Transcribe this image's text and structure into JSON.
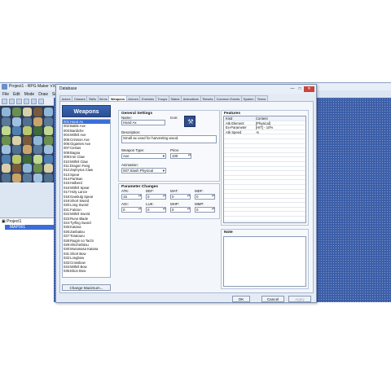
{
  "main_window": {
    "title": "Project1 - RPG Maker VX Ace",
    "menu": [
      "File",
      "Edit",
      "Mode",
      "Draw",
      "Scale"
    ]
  },
  "project_tree": {
    "root": "Project1",
    "selected_map": "MAP001"
  },
  "dialog": {
    "title": "Database",
    "close_label": "✕",
    "min_label": "—",
    "max_label": "□",
    "tabs": [
      "Actors",
      "Classes",
      "Skills",
      "Items",
      "Weapons",
      "Armors",
      "Enemies",
      "Troops",
      "States",
      "Animations",
      "Tilesets",
      "Common Events",
      "System",
      "Terms"
    ],
    "active_tab": "Weapons"
  },
  "weapon_list": {
    "header": "Weapons",
    "selected_index": 0,
    "items": [
      "001:Hand Ax",
      "002:Battle Axe",
      "003:Bardiche",
      "004:Mithril Axe",
      "005:Crimson Axe",
      "006:Gigantes Axe",
      "007:Cestus",
      "008:Bagna",
      "009:Iron Claw",
      "010:Mithril Claw",
      "011:Dragon Fang",
      "012:Zephyrus Claw",
      "013:Spear",
      "014:Partisan",
      "015:Halberd",
      "016:Mithril Spear",
      "017:Holy Lance",
      "018:Gaebulg Spear",
      "019:Short Sword",
      "020:Long Sword",
      "021:Falcion",
      "022:Mithril Sword",
      "023:Rune Blade",
      "024:Tyrfing Sword",
      "025:Katana",
      "026:Zanbatou",
      "027:Toratouru",
      "028:Raigin no Tachi",
      "029:Shichishitou",
      "030:Muramasa Katana",
      "031:Short Bow",
      "032:Longbow",
      "033:Crossbow",
      "034:Mithril Bow",
      "035:Ebon Bow"
    ],
    "change_max_label": "Change Maximum..."
  },
  "general_settings": {
    "title": "General Settings",
    "name_label": "Name:",
    "name_value": "Hand Ax",
    "icon_label": "Icon:",
    "icon_name": "axe-icon",
    "description_label": "Description:",
    "description_value": "Small ax used for harvesting wood.",
    "weapon_type_label": "Weapon Type:",
    "weapon_type_value": "Axe",
    "price_label": "Price:",
    "price_value": "100",
    "animation_label": "Animation:",
    "animation_value": "007:Slash Physical"
  },
  "parameter_changes": {
    "title": "Parameter Changes",
    "params": [
      {
        "label": "ATK:",
        "value": "15"
      },
      {
        "label": "DEF:",
        "value": "0"
      },
      {
        "label": "MAT:",
        "value": "0"
      },
      {
        "label": "MDF:",
        "value": "0"
      },
      {
        "label": "AGI:",
        "value": "0"
      },
      {
        "label": "LUK:",
        "value": "0"
      },
      {
        "label": "MHP:",
        "value": "0"
      },
      {
        "label": "MMP:",
        "value": "0"
      }
    ]
  },
  "features": {
    "title": "Features",
    "col_kind": "Kind",
    "col_content": "Content",
    "rows": [
      {
        "kind": "Atk Element",
        "content": "[Physical]"
      },
      {
        "kind": "Ex-Parameter",
        "content": "[HIT] - 10%"
      },
      {
        "kind": "Atk Speed",
        "content": "-5"
      }
    ]
  },
  "note": {
    "title": "Note",
    "value": ""
  },
  "buttons": {
    "ok": "OK",
    "cancel": "Cancel",
    "apply": "Apply"
  },
  "colors": {
    "selection": "#3a6fd8",
    "map_bg": "#3d5ea8",
    "header_blue": "#2b4f94"
  }
}
